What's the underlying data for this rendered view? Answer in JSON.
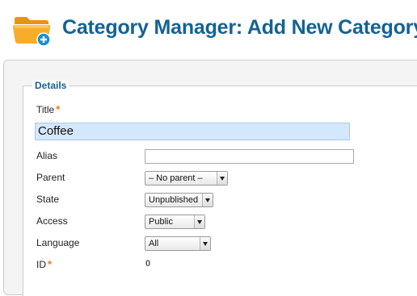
{
  "header": {
    "title": "Category Manager: Add New Category",
    "icon": "folder-add-icon"
  },
  "details": {
    "legend": "Details",
    "title": {
      "label": "Title",
      "required_mark": "*",
      "value": "Coffee"
    },
    "alias": {
      "label": "Alias",
      "value": ""
    },
    "parent": {
      "label": "Parent",
      "selected": "– No parent –"
    },
    "state": {
      "label": "State",
      "selected": "Unpublished"
    },
    "access": {
      "label": "Access",
      "selected": "Public"
    },
    "language": {
      "label": "Language",
      "selected": "All"
    },
    "id": {
      "label": "ID",
      "required_mark": "*",
      "value": "0"
    }
  },
  "colors": {
    "title": "#146295",
    "required": "#ff7500",
    "title_field_bg": "#d4e8fb"
  }
}
